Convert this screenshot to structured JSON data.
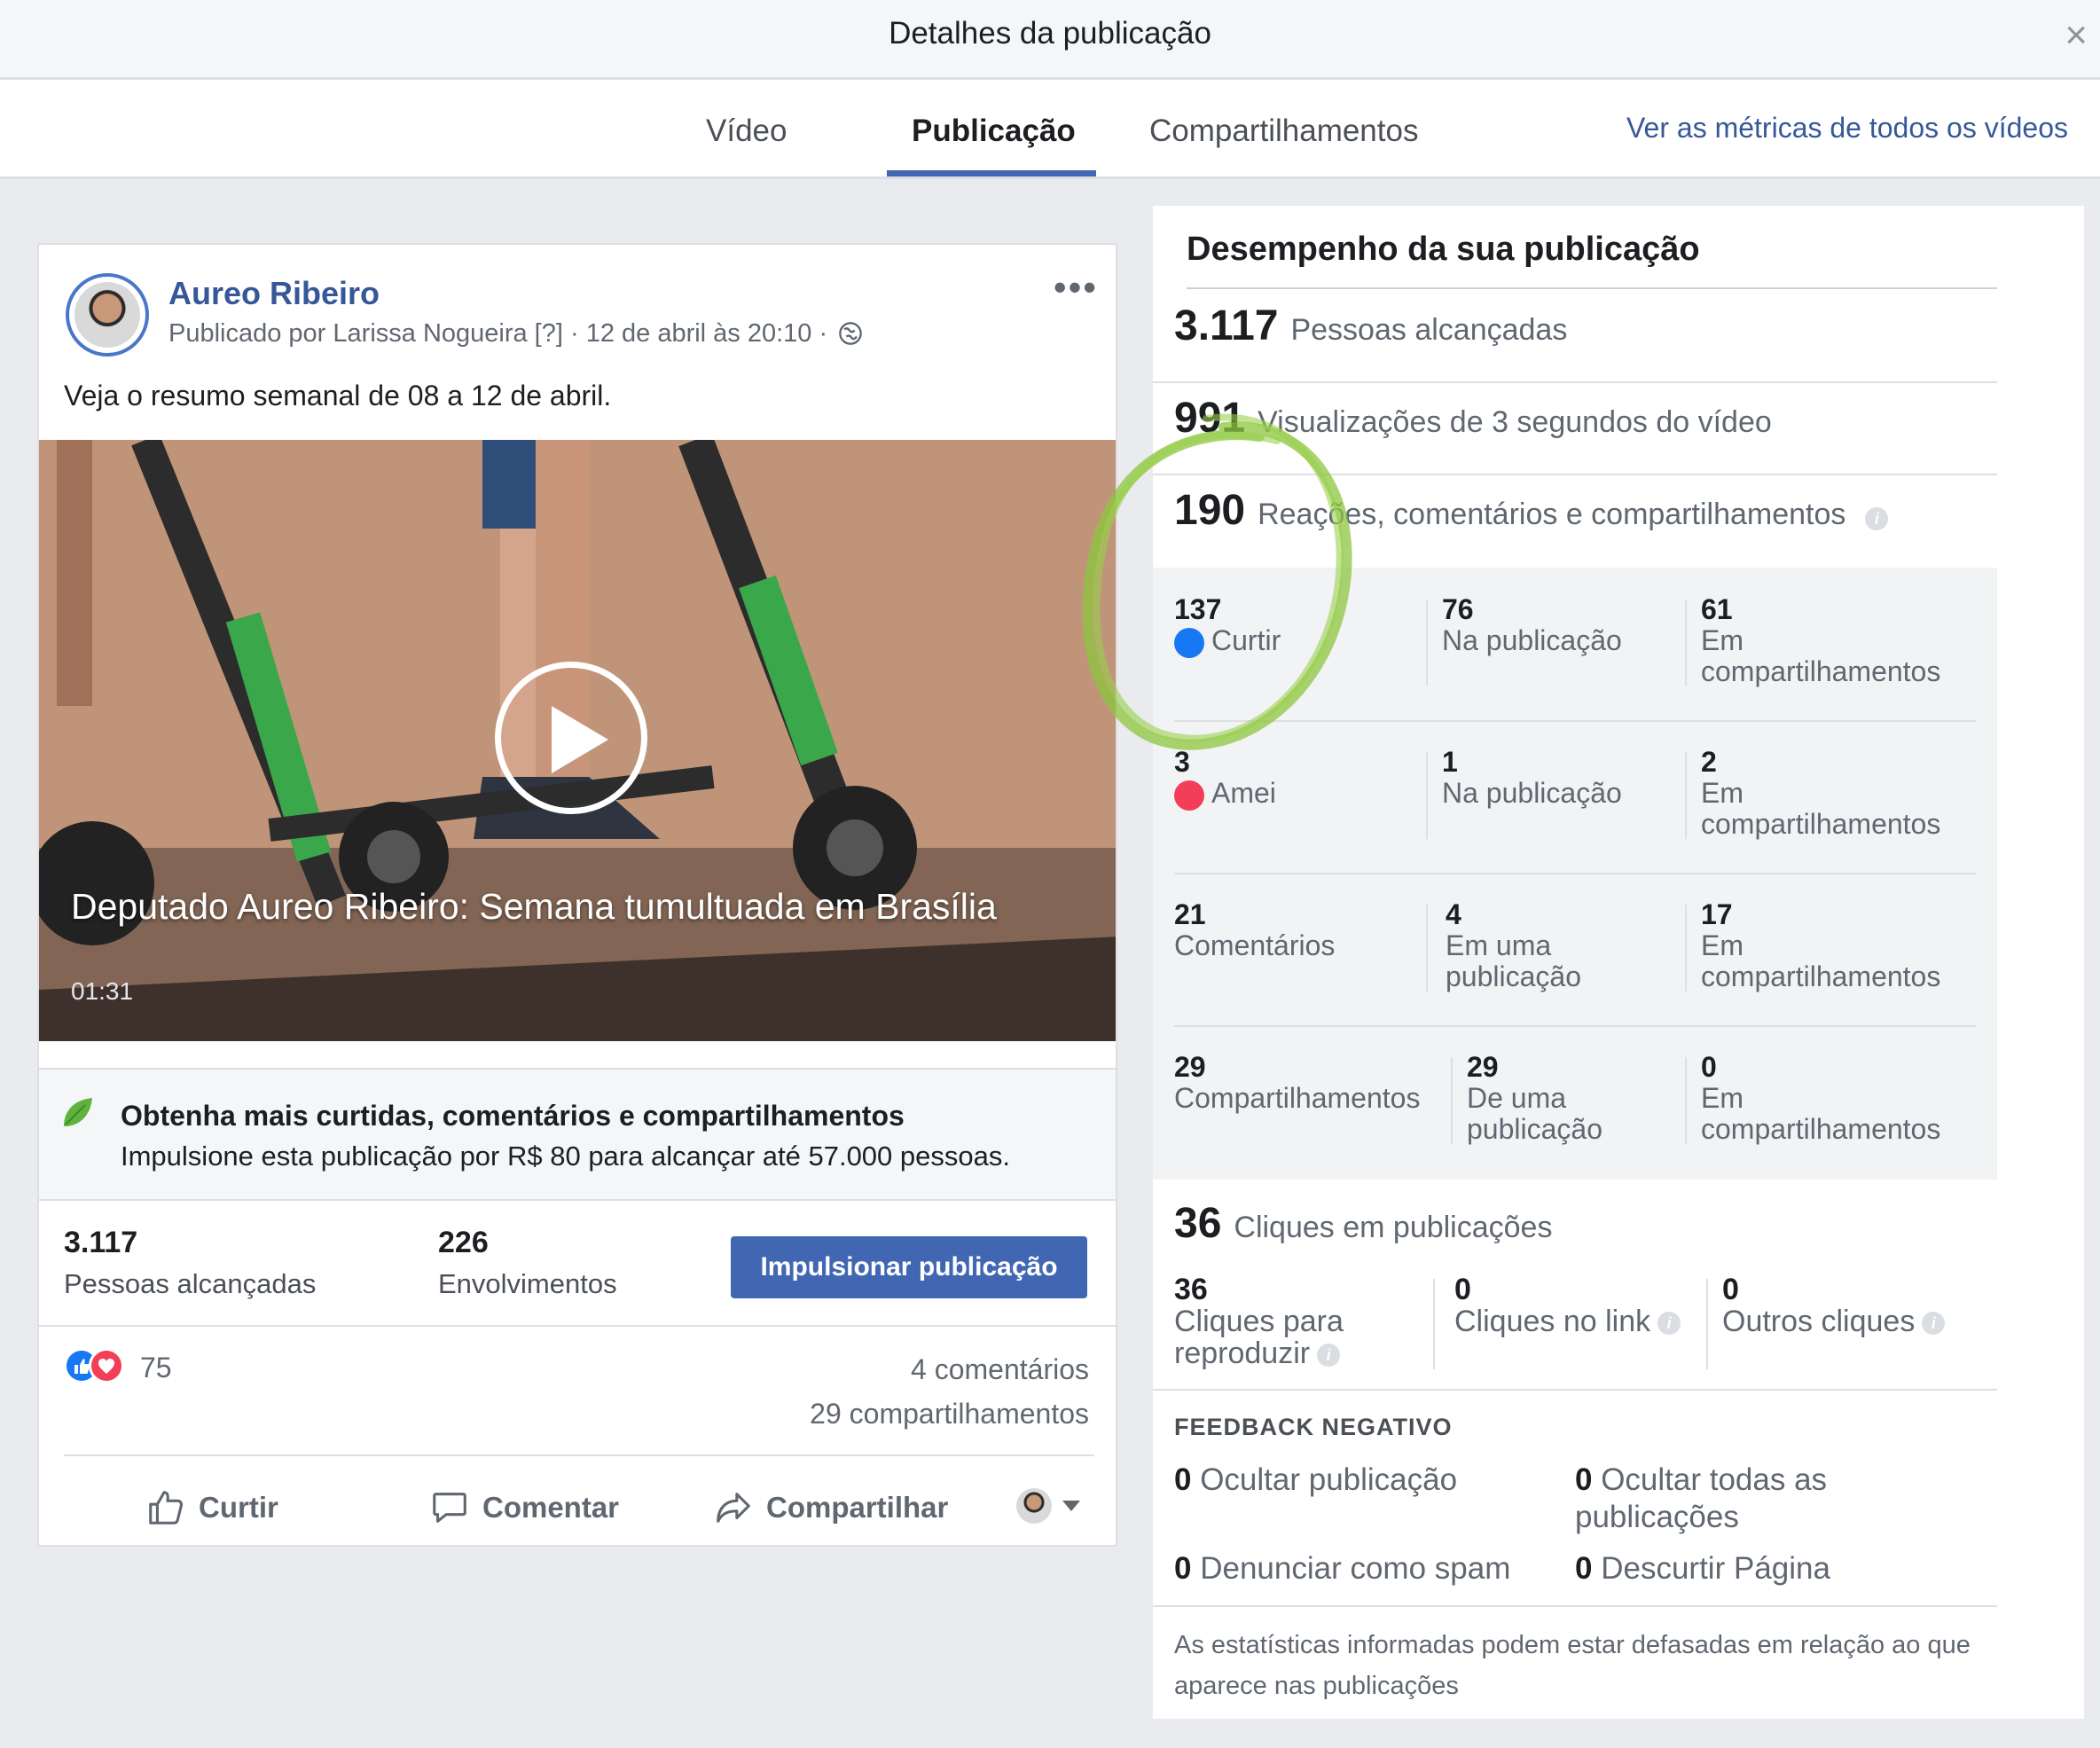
{
  "dialog": {
    "title": "Detalhes da publicação",
    "close_glyph": "×"
  },
  "tabs": [
    {
      "label": "Vídeo",
      "active": false
    },
    {
      "label": "Publicação",
      "active": true
    },
    {
      "label": "Compartilhamentos",
      "active": false
    }
  ],
  "metrics_link": "Ver as métricas de todos os vídeos",
  "post": {
    "author": "Aureo Ribeiro",
    "meta": "Publicado por Larissa Nogueira [?] · 12 de abril às 20:10 ·",
    "more_glyph": "•••",
    "text": "Veja o resumo semanal de 08 a 12 de abril.",
    "video_title": "Deputado Aureo Ribeiro: Semana tumultuada em Brasília",
    "video_duration": "01:31",
    "boost_title": "Obtenha mais curtidas, comentários e compartilhamentos",
    "boost_desc": "Impulsione esta publicação por R$ 80 para alcançar até 57.000 pessoas.",
    "reach_num": "3.117",
    "reach_label": "Pessoas alcançadas",
    "engage_num": "226",
    "engage_label": "Envolvimentos",
    "boost_button": "Impulsionar publicação",
    "reaction_count": "75",
    "comments_count": "4 comentários",
    "shares_count": "29 compartilhamentos",
    "actions": {
      "like": "Curtir",
      "comment": "Comentar",
      "share": "Compartilhar"
    }
  },
  "performance": {
    "title": "Desempenho da sua publicação",
    "reach": {
      "num": "3.117",
      "label": "Pessoas alcançadas"
    },
    "views": {
      "num": "991",
      "label": "Visualizações de 3 segundos do vídeo"
    },
    "engagement": {
      "num": "190",
      "label": "Reações, comentários e compartilhamentos"
    },
    "breakdown": [
      {
        "total": "137",
        "label": "Curtir",
        "on_post": "76",
        "on_post_label": "Na publicação",
        "on_shares": "61",
        "on_shares_label": "Em compartilhamentos"
      },
      {
        "total": "3",
        "label": "Amei",
        "on_post": "1",
        "on_post_label": "Na publicação",
        "on_shares": "2",
        "on_shares_label": "Em compartilhamentos"
      },
      {
        "total": "21",
        "label": "Comentários",
        "on_post": "4",
        "on_post_label": "Em uma publicação",
        "on_shares": "17",
        "on_shares_label": "Em compartilhamentos"
      },
      {
        "total": "29",
        "label": "Compartilhamentos",
        "on_post": "29",
        "on_post_label": "De uma publicação",
        "on_shares": "0",
        "on_shares_label": "Em compartilhamentos"
      }
    ],
    "clicks": {
      "num": "36",
      "label": "Cliques em publicações"
    },
    "click_breakdown": [
      {
        "num": "36",
        "label": "Cliques para reproduzir"
      },
      {
        "num": "0",
        "label": "Cliques no link"
      },
      {
        "num": "0",
        "label": "Outros cliques"
      }
    ],
    "negative_title": "FEEDBACK NEGATIVO",
    "negative": [
      {
        "num": "0",
        "label": "Ocultar publicação"
      },
      {
        "num": "0",
        "label": "Ocultar todas as publicações"
      },
      {
        "num": "0",
        "label": "Denunciar como spam"
      },
      {
        "num": "0",
        "label": "Descurtir Página"
      }
    ],
    "disclaimer": "As estatísticas informadas podem estar defasadas em relação ao que aparece nas publicações"
  },
  "colors": {
    "accent": "#4267b2",
    "link": "#365899",
    "annotation": "#8cc63f"
  }
}
